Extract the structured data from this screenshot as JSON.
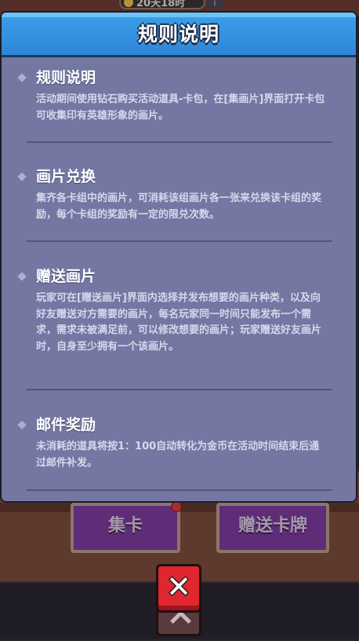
{
  "topbar": {
    "timer": "20天18时",
    "info": "i"
  },
  "background_buttons": {
    "collect": "集卡",
    "gift": "赠送卡牌"
  },
  "dialog": {
    "title": "规则说明",
    "sections": [
      {
        "title": "规则说明",
        "body": "活动期间使用钻石购买活动道具-卡包，在[集画片]界面打开卡包可收集印有英雄形象的画片。"
      },
      {
        "title": "画片兑换",
        "body": "集齐各卡组中的画片，可消耗该组画片各一张来兑换该卡组的奖励，每个卡组的奖励有一定的限兑次数。"
      },
      {
        "title": "赠送画片",
        "body": "玩家可在[赠送画片]界面内选择并发布想要的画片种类，以及向好友赠送对方需要的画片，每名玩家同一时间只能发布一个需求，需求未被满足前，可以修改想要的画片；玩家赠送好友画片时，自身至少拥有一个该画片。"
      },
      {
        "title": "邮件奖励",
        "body": "未消耗的道具将按1：100自动转化为金币在活动时间结束后通过邮件补发。"
      }
    ]
  },
  "close_button": {
    "icon": "close-icon"
  }
}
